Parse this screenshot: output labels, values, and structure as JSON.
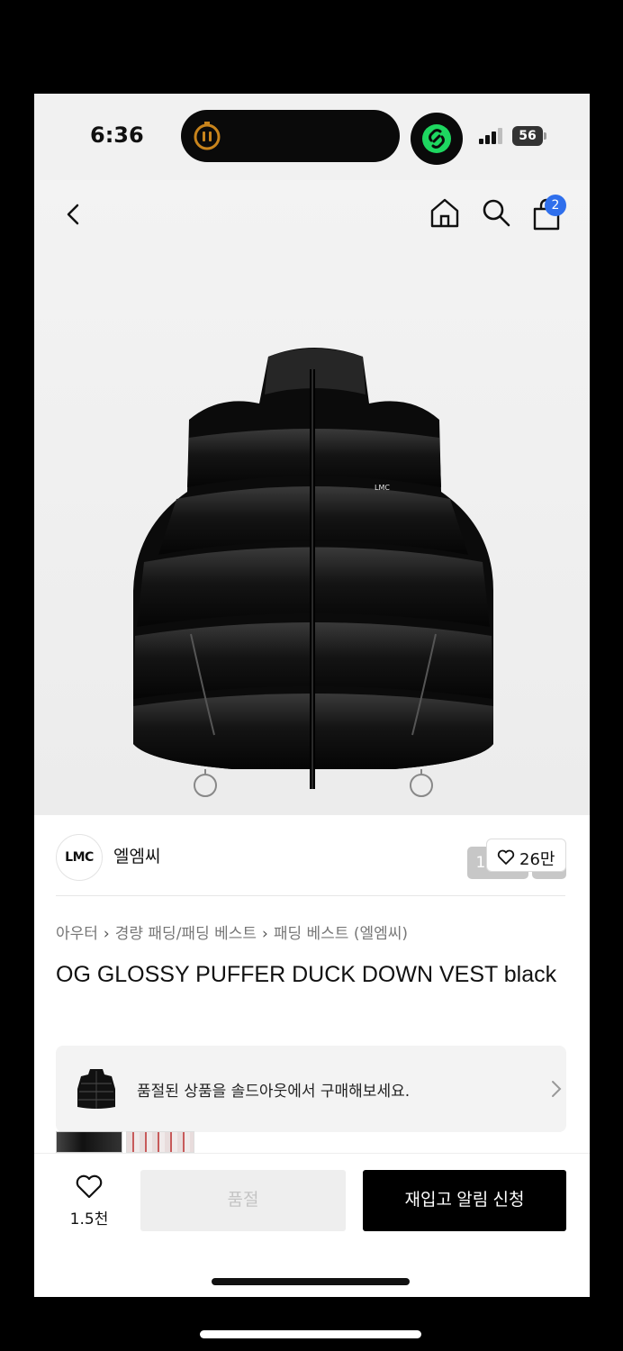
{
  "status_bar": {
    "time": "6:36",
    "battery": "56"
  },
  "nav": {
    "cart_count": "2"
  },
  "gallery": {
    "counter": "1 / 15",
    "garment_label": "LMC"
  },
  "brand": {
    "logo_text": "LMC",
    "name": "엘엠씨",
    "likes": "26만"
  },
  "breadcrumb": [
    "아우터",
    "경량 패딩/패딩 베스트",
    "패딩 베스트 (엘엠씨)"
  ],
  "product": {
    "title": "OG GLOSSY PUFFER DUCK DOWN VEST black"
  },
  "soldout_banner": {
    "text": "품절된 상품을 솔드아웃에서 구매해보세요."
  },
  "bottom_bar": {
    "wish_count": "1.5천",
    "soldout_label": "품절",
    "restock_label": "재입고 알림 신청"
  },
  "colors": {
    "badge": "#2f6fec",
    "primary_button": "#000000",
    "disabled_button": "#eeeeee",
    "island_accent": "#c8841c",
    "app_icon": "#1ed760"
  }
}
